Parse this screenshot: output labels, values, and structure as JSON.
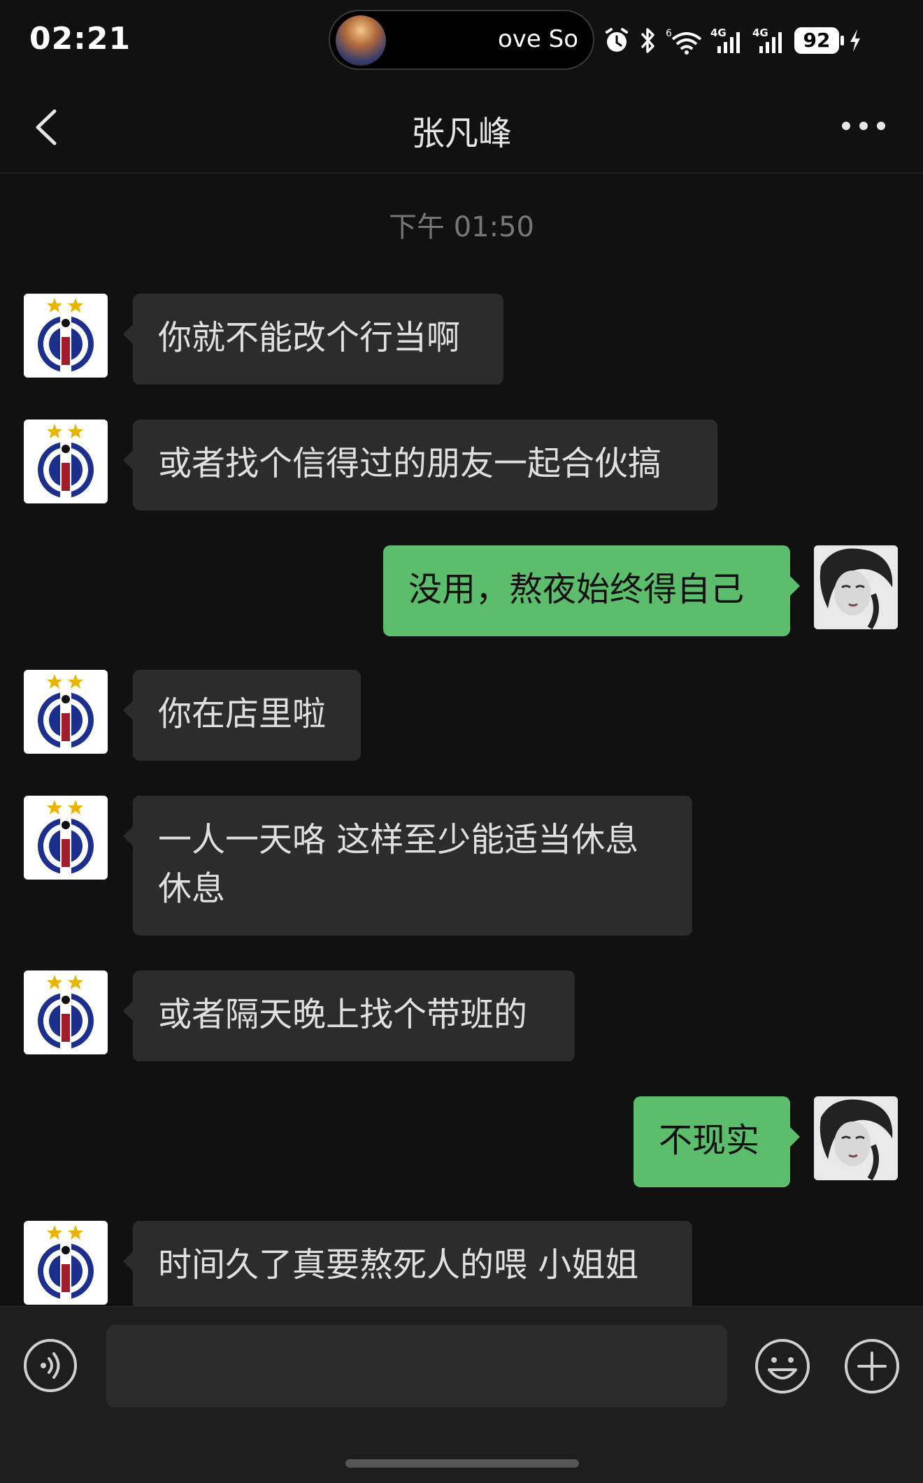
{
  "status_bar": {
    "time": "02:21",
    "now_playing": "ove So",
    "battery": "92",
    "icons": [
      "alarm-icon",
      "bluetooth-icon",
      "wifi-icon",
      "signal-4g-icon",
      "signal-4g-icon",
      "battery-icon",
      "charging-icon"
    ]
  },
  "nav": {
    "title": "张凡峰",
    "back_icon": "chevron-left-icon",
    "more_icon": "more-dots-icon"
  },
  "timestamp": "下午 01:50",
  "messages": [
    {
      "side": "in",
      "text": "你就不能改个行当啊"
    },
    {
      "side": "in",
      "text": "或者找个信得过的朋友一起合伙搞"
    },
    {
      "side": "out",
      "text": "没用，熬夜始终得自己"
    },
    {
      "side": "in",
      "text": "你在店里啦"
    },
    {
      "side": "in",
      "line1": "一人一天咯 这样至少能适当休息",
      "line2": "休息"
    },
    {
      "side": "in",
      "text": "或者隔天晚上找个带班的"
    },
    {
      "side": "out",
      "text": "不现实"
    },
    {
      "side": "in",
      "text": "时间久了真要熬死人的喂 小姐姐"
    }
  ],
  "input_bar": {
    "placeholder": "",
    "icons": [
      "voice-icon",
      "emoji-icon",
      "plus-icon"
    ]
  },
  "colors": {
    "background": "#111111",
    "incoming_bubble": "#2c2c2c",
    "outgoing_bubble": "#5cbd6c",
    "input_bar": "#1e1e1e"
  }
}
